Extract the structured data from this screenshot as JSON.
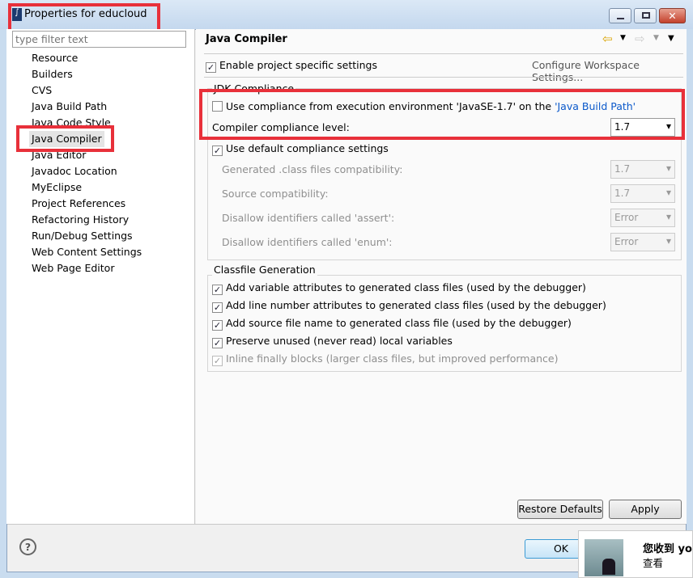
{
  "window": {
    "title": "Properties for educloud"
  },
  "filter": {
    "placeholder": "type filter text"
  },
  "tree": [
    "Resource",
    "Builders",
    "CVS",
    "Java Build Path",
    "Java Code Style",
    "Java Compiler",
    "Java Editor",
    "Javadoc Location",
    "MyEclipse",
    "Project References",
    "Refactoring History",
    "Run/Debug Settings",
    "Web Content Settings",
    "Web Page Editor"
  ],
  "tree_selected": "Java Compiler",
  "page": {
    "title": "Java Compiler",
    "enable_specific": "Enable project specific settings",
    "configure_link": "Configure Workspace Settings...",
    "jdk": {
      "group": "JDK Compliance",
      "use_env_prefix": "Use compliance from execution environment 'JavaSE-1.7' on the ",
      "use_env_link": "'Java Build Path'",
      "level_label": "Compiler compliance level:",
      "level_value": "1.7",
      "use_default": "Use default compliance settings",
      "rows": [
        {
          "label": "Generated .class files compatibility:",
          "value": "1.7"
        },
        {
          "label": "Source compatibility:",
          "value": "1.7"
        },
        {
          "label": "Disallow identifiers called 'assert':",
          "value": "Error"
        },
        {
          "label": "Disallow identifiers called 'enum':",
          "value": "Error"
        }
      ]
    },
    "classfile": {
      "group": "Classfile Generation",
      "items": [
        "Add variable attributes to generated class files (used by the debugger)",
        "Add line number attributes to generated class files (used by the debugger)",
        "Add source file name to generated class file (used by the debugger)",
        "Preserve unused (never read) local variables",
        "Inline finally blocks (larger class files, but improved performance)"
      ]
    }
  },
  "buttons": {
    "restore": "Restore Defaults",
    "apply": "Apply",
    "ok": "OK"
  },
  "notification": {
    "title": "您收到 yo",
    "action": "查看"
  },
  "colors": {
    "highlight": "#e8303a",
    "link": "#0a58ca"
  }
}
